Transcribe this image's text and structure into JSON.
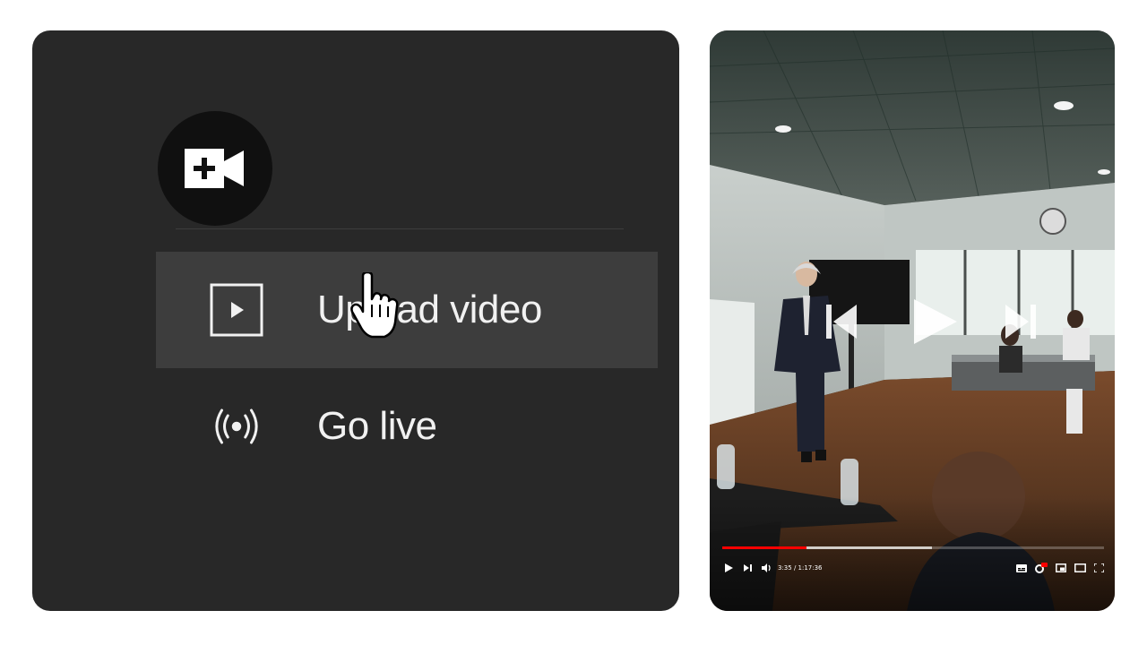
{
  "menu": {
    "items": [
      {
        "label": "Upload video",
        "icon": "play-box-icon",
        "highlighted": true
      },
      {
        "label": "Go live",
        "icon": "live-broadcast-icon",
        "highlighted": false
      }
    ],
    "create_icon": "video-camera-plus-icon"
  },
  "player": {
    "time": "3:35 / 1:17:36",
    "progress_played": 0.22,
    "progress_buffered": 0.55,
    "accent_color": "#ff0000",
    "overlay_controls": [
      "previous-icon",
      "play-icon",
      "next-icon"
    ],
    "bottom_controls": [
      "play-icon",
      "next-icon",
      "volume-icon",
      "subtitles-icon",
      "settings-hd-icon",
      "miniplayer-icon",
      "theater-icon",
      "fullscreen-icon"
    ]
  }
}
